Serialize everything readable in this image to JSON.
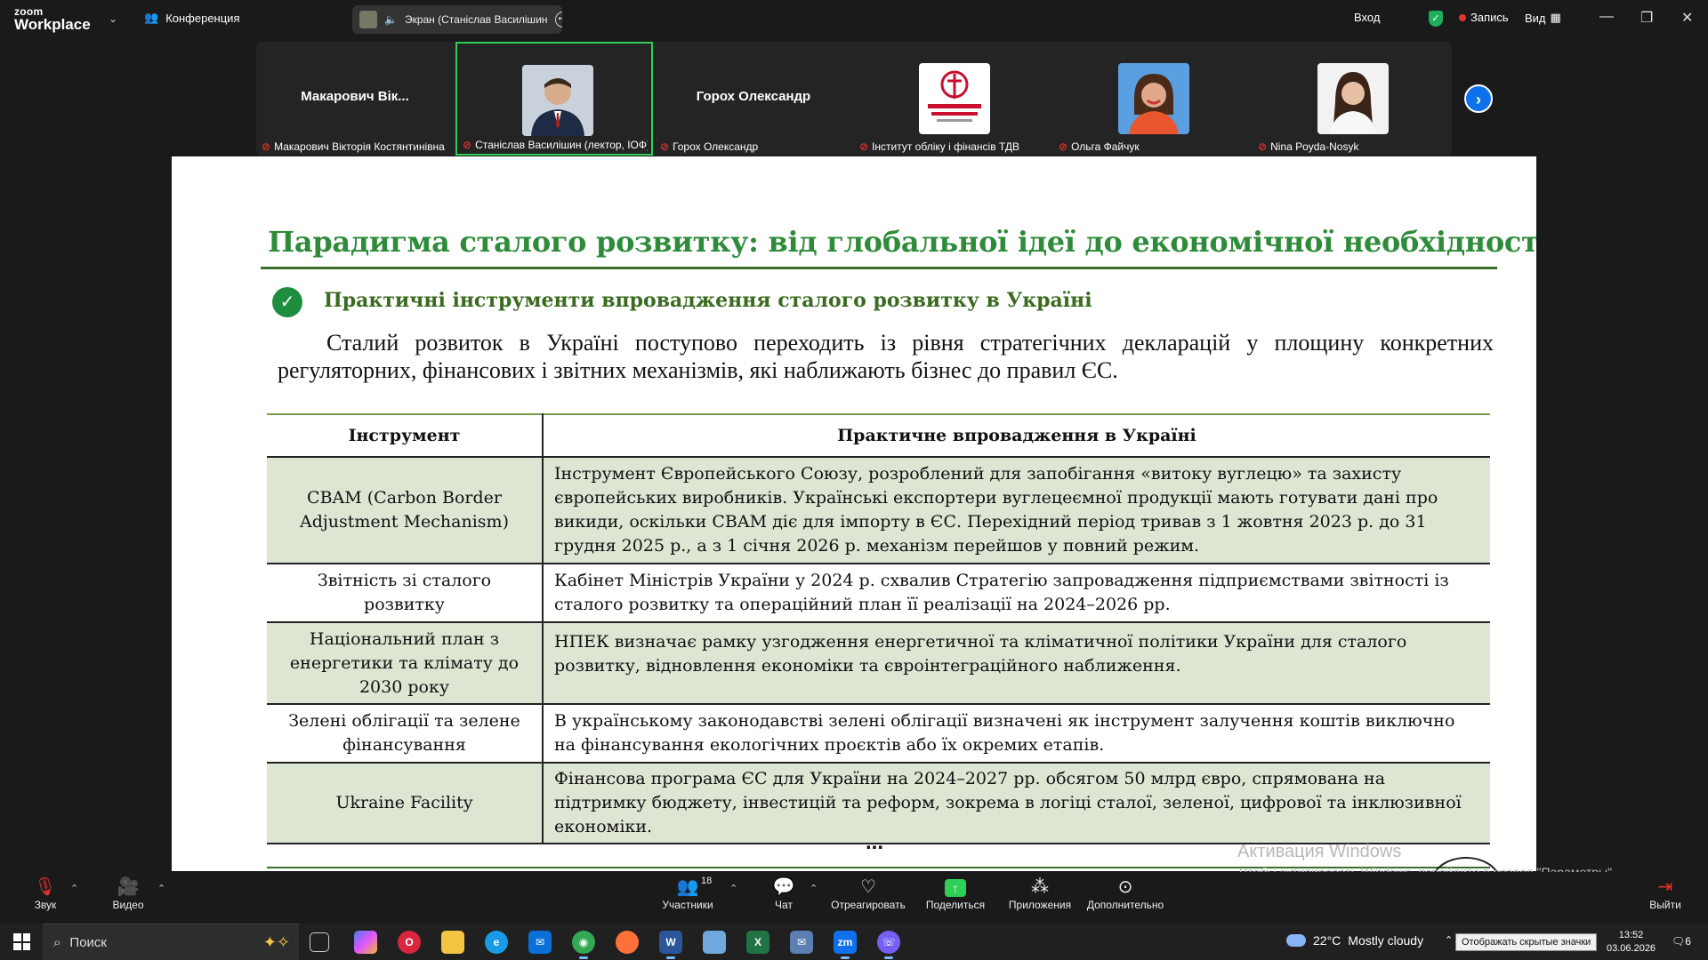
{
  "app": {
    "logo_line1": "zoom",
    "logo_line2": "Workplace",
    "conference_label": "Конференция",
    "screen_share_label": "Экран (Станіслав Василішин",
    "signin": "Вход",
    "record": "Запись",
    "view": "Вид"
  },
  "participants": [
    {
      "big_name": "Макарович  Вік...",
      "caption": "Макарович Вікторія Костянтинівна",
      "has_photo": false,
      "active": false
    },
    {
      "big_name": "",
      "caption": "Станіслав Василішин (лектор, ІОФ)",
      "has_photo": true,
      "active": true
    },
    {
      "big_name": "Горох Олександр",
      "caption": "Горох Олександр",
      "has_photo": false,
      "active": false
    },
    {
      "big_name": "",
      "caption": "Інститут обліку і фінансів ТДВ",
      "has_photo": true,
      "active": false
    },
    {
      "big_name": "",
      "caption": "Ольга Файчук",
      "has_photo": true,
      "active": false
    },
    {
      "big_name": "",
      "caption": "Nina Poyda-Nosyk",
      "has_photo": true,
      "active": false
    }
  ],
  "slide": {
    "title": "Парадигма сталого розвитку: від глобальної ідеї до економічної необхідності",
    "subtitle": "Практичні інструменти впровадження сталого розвитку в Україні",
    "paragraph": "Сталий розвиток в Україні поступово переходить із рівня стратегічних декларацій у площину конкретних регуляторних, фінансових і звітних механізмів, які наближають бізнес до правил ЄС.",
    "table": {
      "headers": [
        "Інструмент",
        "Практичне впровадження в Україні"
      ],
      "rows": [
        {
          "instrument": "CBAM (Carbon Border Adjustment Mechanism)",
          "description": "Інструмент Європейського Союзу, розроблений для запобігання «витоку вуглецю» та захисту європейських виробників. Українські експортери вуглецеємної продукції мають готувати дані про викиди, оскільки CBAM діє для імпорту в ЄС. Перехідний період тривав з 1 жовтня 2023 р. до 31 грудня 2025 р., а з 1 січня 2026 р. механізм перейшов у повний режим."
        },
        {
          "instrument": "Звітність зі сталого розвитку",
          "description": "Кабінет Міністрів України у 2024 р. схвалив Стратегію запровадження підприємствами звітності із сталого розвитку та операційний план її реалізації на 2024–2026 рр."
        },
        {
          "instrument": "Національний план з енергетики та клімату до 2030 року",
          "description": "НПЕК визначає рамку узгодження енергетичної та кліматичної політики України для сталого розвитку, відновлення економіки та євроінтеграційного наближення."
        },
        {
          "instrument": "Зелені облігації та зелене фінансування",
          "description": "В українському законодавстві зелені облігації визначені як інструмент залучення коштів виключно на фінансування екологічних проєктів або їх окремих етапів."
        },
        {
          "instrument": "Ukraine Facility",
          "description": "Фінансова програма ЄС для України на 2024–2027 рр. обсягом 50 млрд євро, спрямована на підтримку бюджету, інвестицій та реформ, зокрема в логіці сталої, зеленої, цифрової та інклюзивної економіки."
        }
      ]
    },
    "ellipsis": "...",
    "watermark_title": "Активация Windows",
    "watermark_text": "Чтобы активировать Windows, перейдите в раздел \"Параметры\"."
  },
  "toolbar": {
    "audio": "Звук",
    "video": "Видео",
    "participants": "Участники",
    "participants_count": "18",
    "chat": "Чат",
    "react": "Отреагировать",
    "share": "Поделиться",
    "apps": "Приложения",
    "more": "Дополнительно",
    "leave": "Выйти"
  },
  "taskbar": {
    "search_placeholder": "Поиск",
    "temperature": "22°C",
    "weather": "Mostly cloudy",
    "hidden_icons_tooltip": "Отображать скрытые значки",
    "time": "13:52",
    "date": "03.06.2026",
    "notification_count": "6"
  },
  "colors": {
    "slide_title": "#2e8b3a",
    "subtitle": "#3a6b1f",
    "row_shade": "#dce6d3",
    "active_tile": "#2fce57",
    "zoom_blue": "#0e71eb"
  }
}
